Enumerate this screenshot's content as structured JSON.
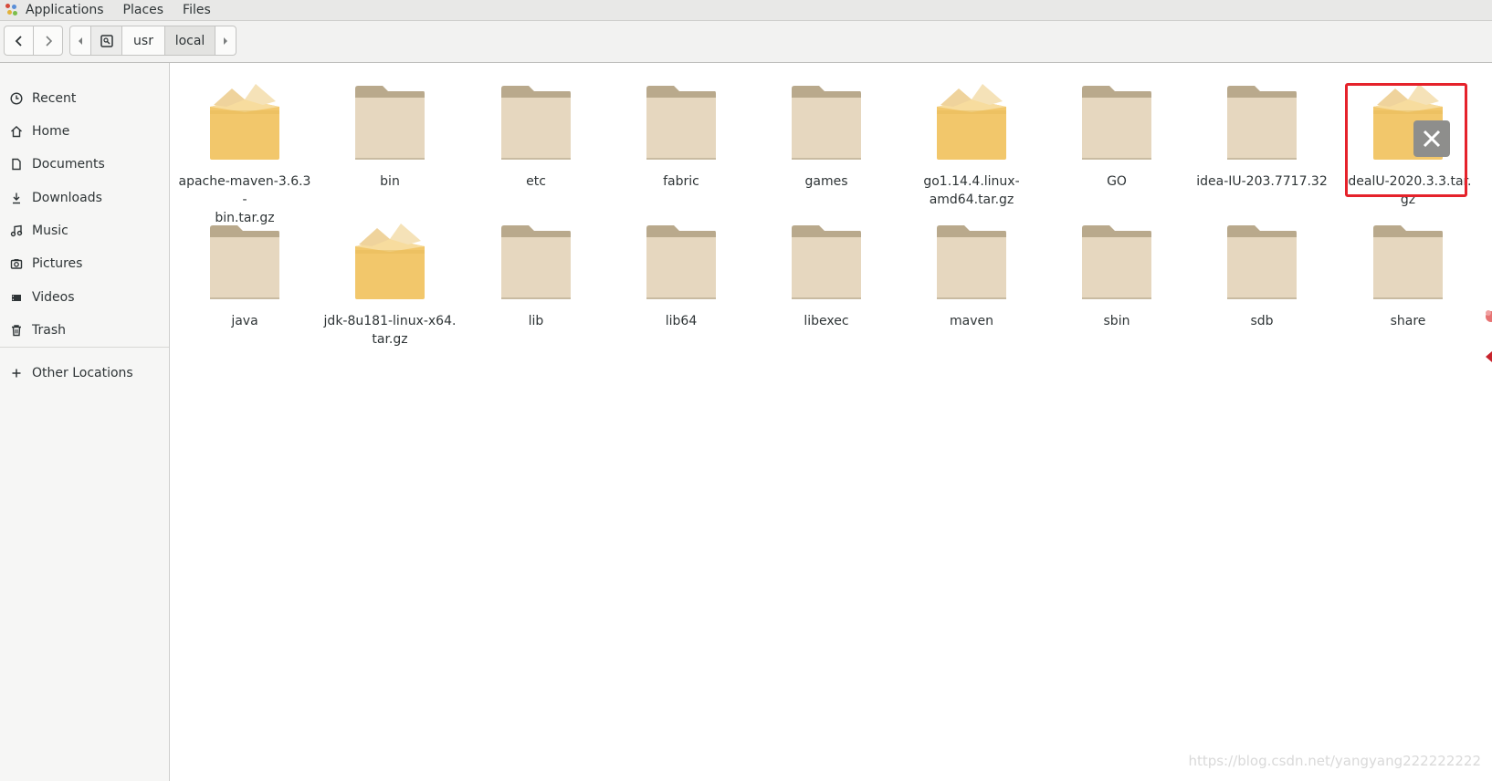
{
  "topbar": {
    "menus": [
      "Applications",
      "Places",
      "Files"
    ]
  },
  "pathbar": {
    "segments": [
      "usr",
      "local"
    ]
  },
  "sidebar": {
    "items": [
      {
        "label": "Recent",
        "icon": "clock-icon"
      },
      {
        "label": "Home",
        "icon": "home-icon"
      },
      {
        "label": "Documents",
        "icon": "document-icon"
      },
      {
        "label": "Downloads",
        "icon": "download-icon"
      },
      {
        "label": "Music",
        "icon": "music-icon"
      },
      {
        "label": "Pictures",
        "icon": "camera-icon"
      },
      {
        "label": "Videos",
        "icon": "video-icon"
      },
      {
        "label": "Trash",
        "icon": "trash-icon"
      }
    ],
    "other_locations": "Other Locations"
  },
  "files": [
    {
      "name": "apache-maven-3.6.3-bin.tar.gz",
      "line1": "apache-maven-3.6.3-",
      "line2": "bin.tar.gz",
      "kind": "archive"
    },
    {
      "name": "bin",
      "line1": "bin",
      "line2": "",
      "kind": "folder"
    },
    {
      "name": "etc",
      "line1": "etc",
      "line2": "",
      "kind": "folder"
    },
    {
      "name": "fabric",
      "line1": "fabric",
      "line2": "",
      "kind": "folder"
    },
    {
      "name": "games",
      "line1": "games",
      "line2": "",
      "kind": "folder"
    },
    {
      "name": "go1.14.4.linux-amd64.tar.gz",
      "line1": "go1.14.4.linux-",
      "line2": "amd64.tar.gz",
      "kind": "archive"
    },
    {
      "name": "GO",
      "line1": "GO",
      "line2": "",
      "kind": "folder"
    },
    {
      "name": "idea-IU-203.7717.32",
      "line1": "idea-IU-203.7717.32",
      "line2": "",
      "kind": "folder"
    },
    {
      "name": "idealU-2020.3.3.tar.gz",
      "line1": "idealU-2020.3.3.tar.",
      "line2": "gz",
      "kind": "archive"
    },
    {
      "name": "java",
      "line1": "java",
      "line2": "",
      "kind": "folder"
    },
    {
      "name": "jdk-8u181-linux-x64.tar.gz",
      "line1": "jdk-8u181-linux-x64.",
      "line2": "tar.gz",
      "kind": "archive"
    },
    {
      "name": "lib",
      "line1": "lib",
      "line2": "",
      "kind": "folder"
    },
    {
      "name": "lib64",
      "line1": "lib64",
      "line2": "",
      "kind": "folder"
    },
    {
      "name": "libexec",
      "line1": "libexec",
      "line2": "",
      "kind": "folder"
    },
    {
      "name": "maven",
      "line1": "maven",
      "line2": "",
      "kind": "folder"
    },
    {
      "name": "sbin",
      "line1": "sbin",
      "line2": "",
      "kind": "folder"
    },
    {
      "name": "sdb",
      "line1": "sdb",
      "line2": "",
      "kind": "folder"
    },
    {
      "name": "share",
      "line1": "share",
      "line2": "",
      "kind": "folder"
    }
  ],
  "colors": {
    "highlight": "#e5222b",
    "folder_body": "#e6d7bf",
    "folder_tab": "#b9a98c",
    "archive_body": "#f2c76b"
  },
  "watermark": "https://blog.csdn.net/yangyang222222222"
}
